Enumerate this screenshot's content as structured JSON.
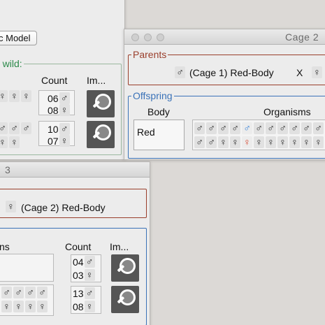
{
  "window_left": {
    "model_button": "c Model",
    "wild_legend": "e wild:",
    "count_header": "Count",
    "images_header": "Im...",
    "rows": [
      {
        "male_count": "06",
        "female_count": "08"
      },
      {
        "male_count": "10",
        "female_count": "07"
      }
    ]
  },
  "window_right": {
    "title": "Cage  2",
    "parents_legend": "Parents",
    "parent1_symbol": "♂",
    "parent1_text": "(Cage  1) Red-Body",
    "cross_symbol": "X",
    "parent2_symbol": "♀",
    "offspring_legend": "Offspring",
    "body_header": "Body",
    "organisms_header": "Organisms",
    "body_value": "Red"
  },
  "window_bottom": {
    "title": " 3",
    "parent_symbol": "♀",
    "parent_text": "(Cage  2) Red-Body",
    "organisms_header": "ns",
    "count_header": "Count",
    "images_header": "Im...",
    "rows": [
      {
        "male_count": "04",
        "female_count": "03"
      },
      {
        "male_count": "13",
        "female_count": "08"
      }
    ]
  },
  "symbols": {
    "male": "♂",
    "female": "♀"
  },
  "colors": {
    "parents_border": "#9a3e2b",
    "offspring_border": "#3a72b8",
    "wild_label": "#2c8a4a",
    "highlight_male": "#2f7dd8",
    "highlight_female": "#d4432a"
  }
}
